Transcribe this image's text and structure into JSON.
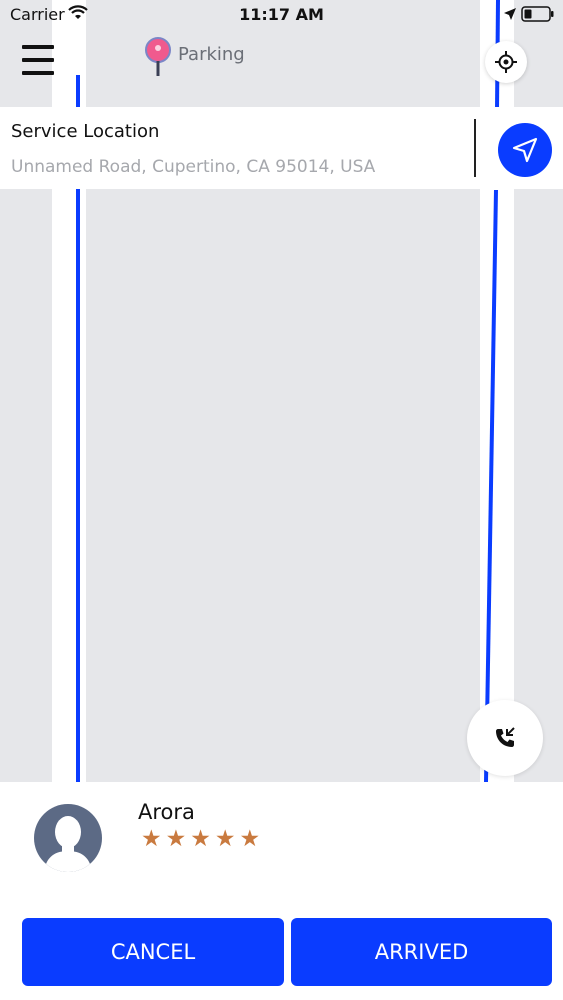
{
  "status_bar": {
    "carrier": "Carrier",
    "time": "11:17 AM"
  },
  "map": {
    "poi_label": "Parking",
    "route_color": "#0a3cff"
  },
  "service_location": {
    "title": "Service Location",
    "address": "Unnamed Road, Cupertino, CA 95014, USA"
  },
  "driver": {
    "name": "Arora",
    "rating_stars": "★★★★★",
    "rating": 5
  },
  "actions": {
    "cancel_label": "CANCEL",
    "arrived_label": "ARRIVED"
  },
  "colors": {
    "accent": "#0a3cff",
    "star": "#c97a3f",
    "avatar_bg": "#5c6a85"
  },
  "icons": [
    "wifi-icon",
    "location-arrow-icon",
    "battery-icon",
    "hamburger-menu-icon",
    "parking-pin-icon",
    "gps-target-icon",
    "navigation-arrow-icon",
    "phone-call-icon",
    "avatar-silhouette-icon"
  ]
}
